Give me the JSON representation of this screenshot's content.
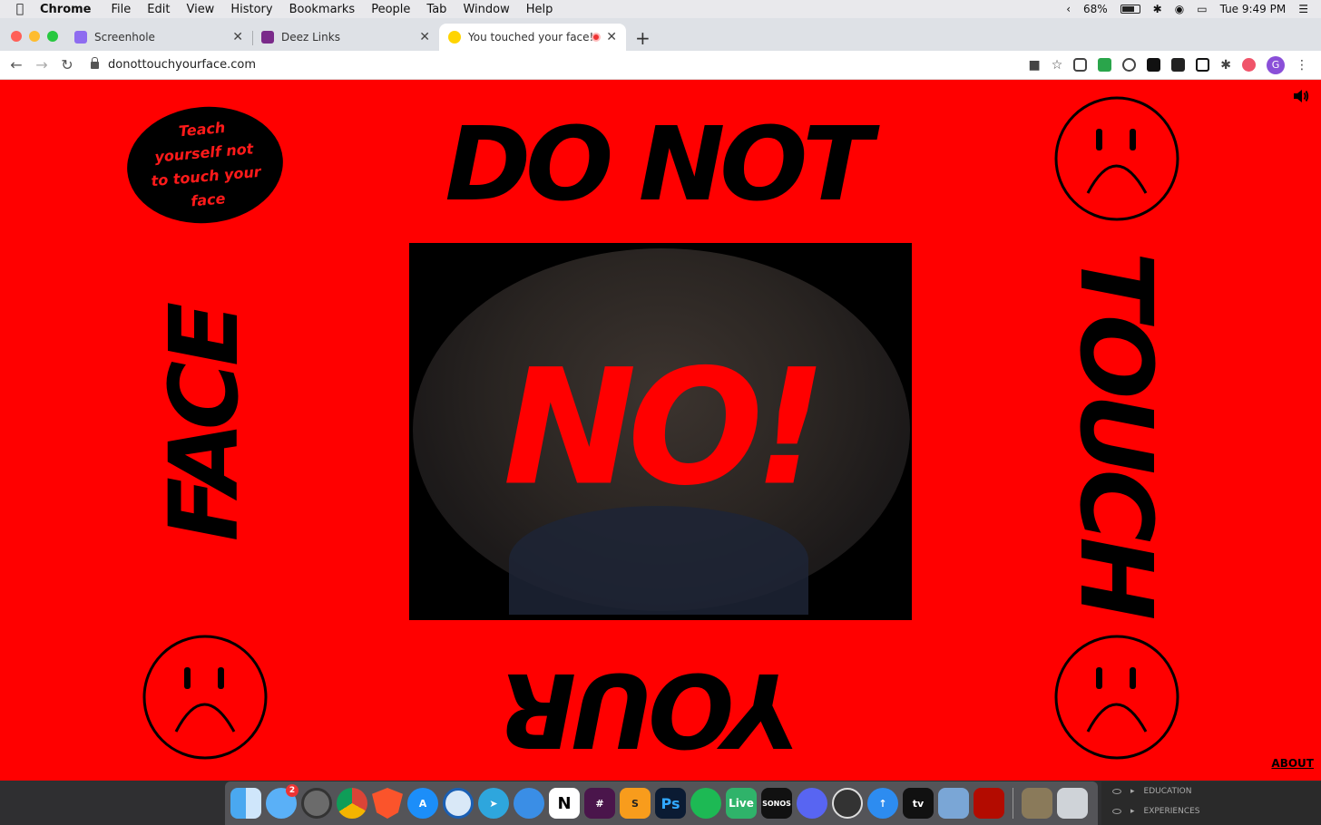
{
  "menubar": {
    "app": "Chrome",
    "items": [
      "File",
      "Edit",
      "View",
      "History",
      "Bookmarks",
      "People",
      "Tab",
      "Window",
      "Help"
    ],
    "battery": "68%",
    "clock": "Tue 9:49 PM"
  },
  "tabs": [
    {
      "label": "Screenhole",
      "color": "#8e6cf0"
    },
    {
      "label": "Deez Links",
      "color": "#7a2a8a"
    },
    {
      "label": "You touched your face!",
      "color": "#ffd400"
    }
  ],
  "toolbar": {
    "url": "donottouchyourface.com",
    "avatar": "G"
  },
  "page": {
    "top_word": "DO NOT",
    "right_word": "TOUCH",
    "bottom_word": "YOUR",
    "left_word": "FACE",
    "blob_text": "Teach yourself not to touch your face",
    "alert": "NO!",
    "about": "ABOUT",
    "colors": {
      "background": "#ff0000",
      "ink": "#000000"
    }
  },
  "dock": {
    "live_label": "Live",
    "sonos_label": "SONOS",
    "ps_label": "Ps",
    "mail_badge": "2"
  },
  "sidepanel": {
    "items": [
      "EDUCATION",
      "EXPERIENCES"
    ]
  }
}
